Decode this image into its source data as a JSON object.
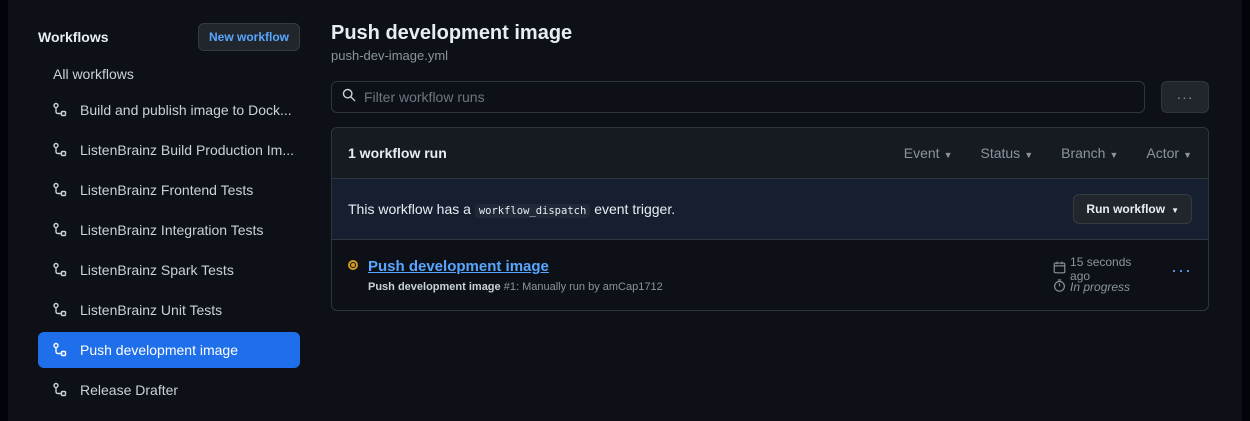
{
  "sidebar": {
    "title": "Workflows",
    "new_workflow_label": "New workflow",
    "all_workflows_label": "All workflows",
    "items": [
      {
        "label": "Build and publish image to Dock..."
      },
      {
        "label": "ListenBrainz Build Production Im..."
      },
      {
        "label": "ListenBrainz Frontend Tests"
      },
      {
        "label": "ListenBrainz Integration Tests"
      },
      {
        "label": "ListenBrainz Spark Tests"
      },
      {
        "label": "ListenBrainz Unit Tests"
      },
      {
        "label": "Push development image",
        "active": true
      },
      {
        "label": "Release Drafter"
      }
    ]
  },
  "main": {
    "title": "Push development image",
    "subtitle": "push-dev-image.yml",
    "filter_placeholder": "Filter workflow runs",
    "more_label": "···",
    "runs_count": "1 workflow run",
    "filters": [
      "Event",
      "Status",
      "Branch",
      "Actor"
    ],
    "dispatch": {
      "prefix": "This workflow has a",
      "code": "workflow_dispatch",
      "suffix": "event trigger.",
      "run_button": "Run workflow"
    },
    "runs": [
      {
        "title": "Push development image",
        "meta_bold": "Push development image",
        "meta_rest": "#1: Manually run by amCap1712",
        "time": "15 seconds ago",
        "status": "In progress",
        "status_color": "#d29922"
      }
    ]
  },
  "colors": {
    "background": "#0d1117",
    "accent": "#1f6feb",
    "link": "#58a6ff",
    "in_progress": "#d29922"
  }
}
